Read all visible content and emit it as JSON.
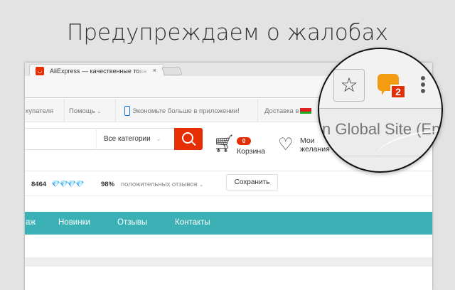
{
  "headline": "Предупреждаем о жалобах",
  "browser": {
    "tab_title": "AliExpress — качественные то",
    "tab_fade": "ва",
    "tab_close": "×"
  },
  "topnav": {
    "buyer": "купателя",
    "help": "Помощь",
    "help_chev": "⌄",
    "app": "Экономьте больше в приложении!",
    "delivery": "Доставка в"
  },
  "search": {
    "category": "Все категории",
    "chev": "⌄"
  },
  "cart": {
    "count": "0",
    "label": "Корзина"
  },
  "wishlist": {
    "line1": "Мои",
    "line2": "желания"
  },
  "store": {
    "score": "8464",
    "diamonds": "💎💎💎💎",
    "percent": "98%",
    "feedback": "положительных отзывов",
    "chev": "⌄",
    "save": "Сохранить"
  },
  "teal_nav": [
    "аж",
    "Новинки",
    "Отзывы",
    "Контакты"
  ],
  "magnifier": {
    "badge": "2",
    "global_site": "n Global Site (Eng",
    "wish_line1": "и",
    "wish_line2": "ания"
  },
  "colors": {
    "accent": "#e62e04",
    "teal": "#3bb1b6",
    "chat": "#f39c12"
  }
}
